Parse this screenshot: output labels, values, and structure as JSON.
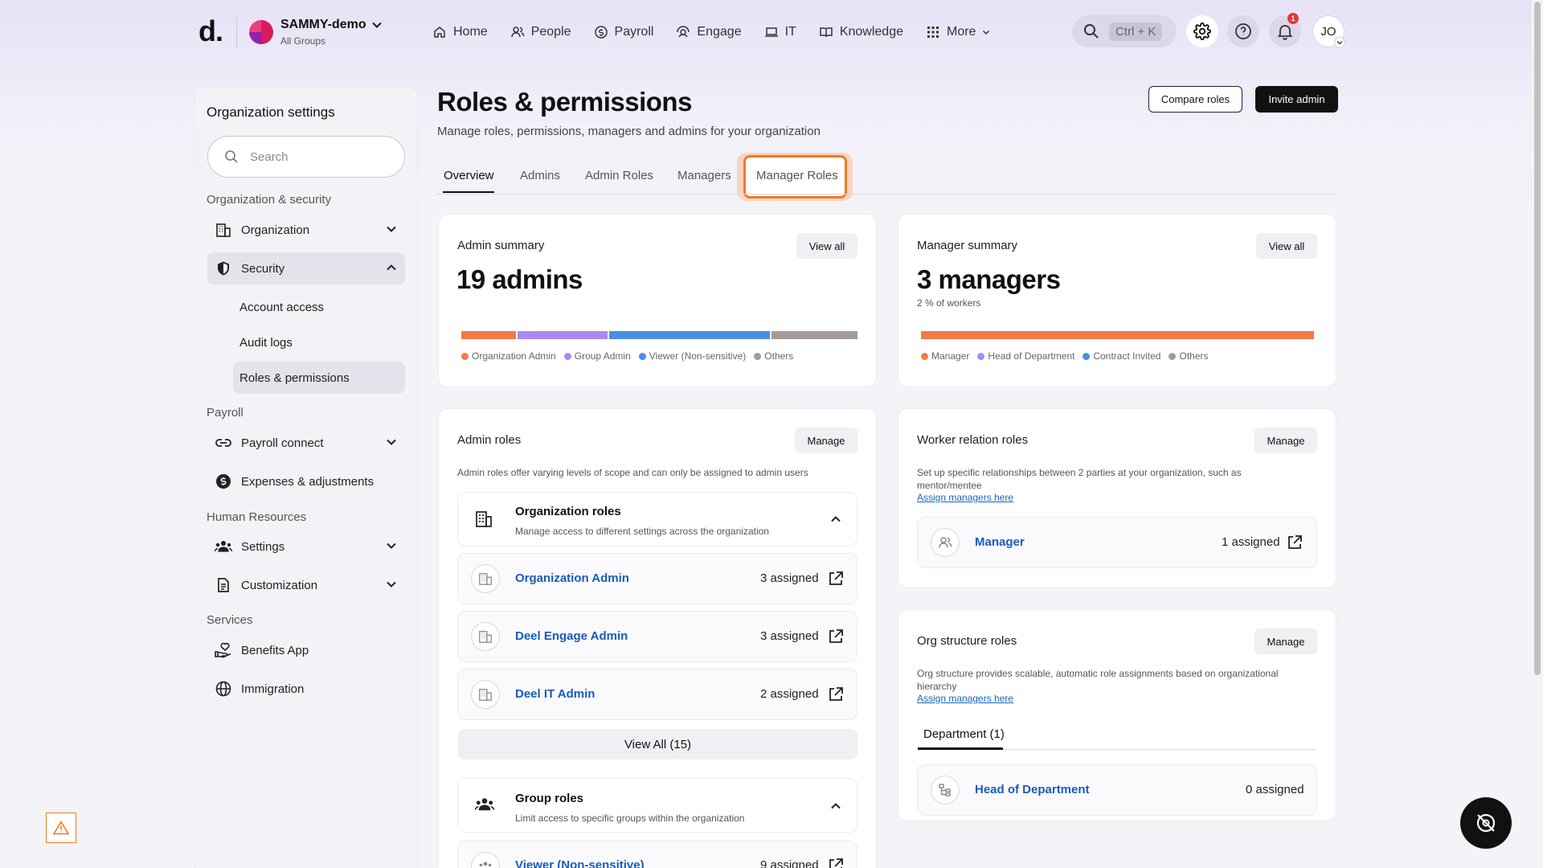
{
  "topbar": {
    "logo": "d.",
    "workspace": {
      "name": "SAMMY-demo",
      "subtitle": "All Groups"
    },
    "nav": [
      {
        "label": "Home",
        "icon": "home-icon"
      },
      {
        "label": "People",
        "icon": "people-icon"
      },
      {
        "label": "Payroll",
        "icon": "payroll-icon"
      },
      {
        "label": "Engage",
        "icon": "engage-icon"
      },
      {
        "label": "IT",
        "icon": "laptop-icon"
      },
      {
        "label": "Knowledge",
        "icon": "book-icon"
      },
      {
        "label": "More",
        "icon": "grid-icon"
      }
    ],
    "search_shortcut": "Ctrl + K",
    "notifications_count": "1",
    "user_initials": "JO"
  },
  "sidebar": {
    "title": "Organization settings",
    "search_placeholder": "Search",
    "section_org_security": "Organization & security",
    "organization": "Organization",
    "security": "Security",
    "account_access": "Account access",
    "audit_logs": "Audit logs",
    "roles_permissions": "Roles & permissions",
    "section_payroll": "Payroll",
    "payroll_connect": "Payroll connect",
    "expenses": "Expenses & adjustments",
    "section_hr": "Human Resources",
    "settings": "Settings",
    "customization": "Customization",
    "section_services": "Services",
    "benefits": "Benefits App",
    "immigration": "Immigration"
  },
  "header": {
    "title": "Roles & permissions",
    "subtitle": "Manage roles, permissions, managers and admins for your organization",
    "compare_roles": "Compare roles",
    "invite_admin": "Invite admin"
  },
  "tabs": [
    "Overview",
    "Admins",
    "Admin Roles",
    "Managers",
    "Manager Roles"
  ],
  "admin_summary": {
    "title": "Admin summary",
    "view_all": "View all",
    "count": "19 admins",
    "bar_fractions": [
      0.14,
      0.23,
      0.41,
      0.22
    ],
    "legend": [
      "Organization Admin",
      "Group Admin",
      "Viewer (Non-sensitive)",
      "Others"
    ]
  },
  "manager_summary": {
    "title": "Manager summary",
    "view_all": "View all",
    "count": "3 managers",
    "pct": "2 % of workers",
    "bar_fractions": [
      1.0
    ],
    "legend": [
      "Manager",
      "Head of Department",
      "Contract Invited",
      "Others"
    ]
  },
  "admin_roles": {
    "title": "Admin roles",
    "manage": "Manage",
    "desc": "Admin roles offer varying levels of scope and can only be assigned to admin users",
    "org_group": {
      "title": "Organization roles",
      "desc": "Manage access to different settings across the organization"
    },
    "rows": [
      {
        "name": "Organization Admin",
        "count": "3 assigned"
      },
      {
        "name": "Deel Engage Admin",
        "count": "3 assigned"
      },
      {
        "name": "Deel IT Admin",
        "count": "2 assigned"
      }
    ],
    "view_all": "View All (15)",
    "group_roles": {
      "title": "Group roles",
      "desc": "Limit access to specific groups within the organization"
    },
    "group_row": {
      "name": "Viewer (Non-sensitive)",
      "count": "9 assigned"
    }
  },
  "worker_relation": {
    "title": "Worker relation roles",
    "manage": "Manage",
    "desc": "Set up specific relationships between 2 parties at your organization, such as mentor/mentee",
    "link": "Assign managers here",
    "row": {
      "name": "Manager",
      "count": "1 assigned"
    }
  },
  "org_structure": {
    "title": "Org structure roles",
    "manage": "Manage",
    "desc": "Org structure provides scalable, automatic role assignments based on organizational hierarchy",
    "link": "Assign managers here",
    "tab": "Department (1)",
    "row": {
      "name": "Head of Department",
      "count": "0 assigned"
    }
  },
  "colors": {
    "orange": "#f4794a",
    "purple": "#a98bf0",
    "blue": "#4a90e2",
    "gray": "#a49b96",
    "accent_highlight": "#f4791f"
  }
}
